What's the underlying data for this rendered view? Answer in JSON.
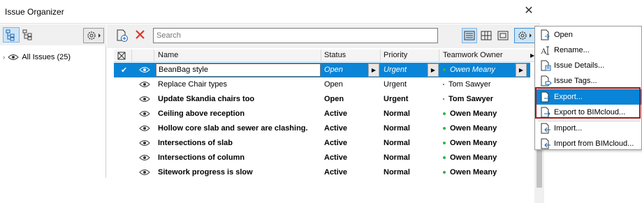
{
  "window": {
    "title": "Issue Organizer"
  },
  "search": {
    "placeholder": "Search"
  },
  "tree": {
    "root_label": "All Issues (25)"
  },
  "columns": {
    "name": "Name",
    "status": "Status",
    "priority": "Priority",
    "owner": "Teamwork Owner"
  },
  "issues": [
    {
      "name": "BeanBag style",
      "status": "Open",
      "priority": "Urgent",
      "owner": "Owen Meany",
      "bold": false,
      "selected": true,
      "owner_dot": "#2fb44a"
    },
    {
      "name": "Replace Chair types",
      "status": "Open",
      "priority": "Urgent",
      "owner": "Tom Sawyer",
      "bold": false,
      "selected": false,
      "owner_dot": "#555555"
    },
    {
      "name": "Update Skandia chairs too",
      "status": "Open",
      "priority": "Urgent",
      "owner": "Tom Sawyer",
      "bold": true,
      "selected": false,
      "owner_dot": "#555555"
    },
    {
      "name": "Ceiling above reception",
      "status": "Active",
      "priority": "Normal",
      "owner": "Owen Meany",
      "bold": true,
      "selected": false,
      "owner_dot": "#2fb44a"
    },
    {
      "name": "Hollow core slab and sewer are clashing.",
      "status": "Active",
      "priority": "Normal",
      "owner": "Owen Meany",
      "bold": true,
      "selected": false,
      "owner_dot": "#2fb44a"
    },
    {
      "name": "Intersections of slab",
      "status": "Active",
      "priority": "Normal",
      "owner": "Owen Meany",
      "bold": true,
      "selected": false,
      "owner_dot": "#2fb44a"
    },
    {
      "name": "Intersections of column",
      "status": "Active",
      "priority": "Normal",
      "owner": "Owen Meany",
      "bold": true,
      "selected": false,
      "owner_dot": "#2fb44a"
    },
    {
      "name": "Sitework progress is slow",
      "status": "Active",
      "priority": "Normal",
      "owner": "Owen Meany",
      "bold": true,
      "selected": false,
      "owner_dot": "#2fb44a"
    }
  ],
  "menu": {
    "open": "Open",
    "rename": "Rename...",
    "details": "Issue Details...",
    "tags": "Issue Tags...",
    "export": "Export...",
    "export_bimcloud": "Export to BIMcloud...",
    "import": "Import...",
    "import_bimcloud": "Import from BIMcloud..."
  },
  "colors": {
    "selection": "#0a84d6",
    "highlight_border": "#9b1d1d",
    "delete_red": "#e2322b",
    "online_green": "#2fb44a"
  }
}
